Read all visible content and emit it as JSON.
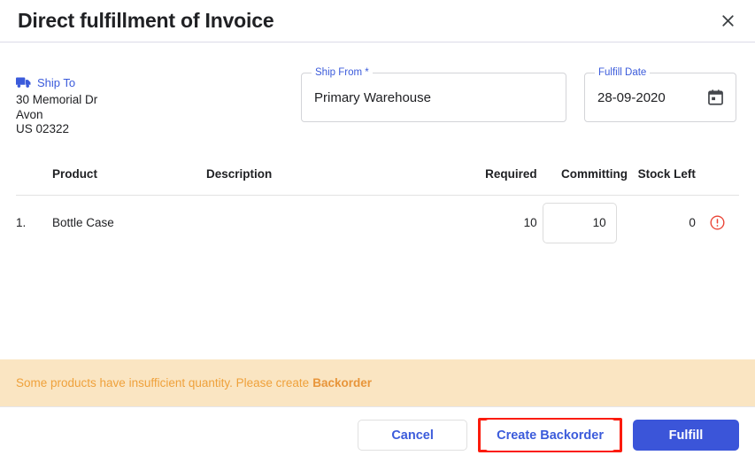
{
  "dialog": {
    "title": "Direct fulfillment of Invoice",
    "close_icon": "close-icon"
  },
  "ship_to": {
    "icon": "truck-icon",
    "label": "Ship To",
    "address_lines": [
      "30 Memorial Dr",
      "Avon",
      "US 02322"
    ]
  },
  "fields": {
    "ship_from": {
      "label": "Ship From *",
      "value": "Primary Warehouse",
      "placeholder": "Ship From"
    },
    "fulfill_date": {
      "label": "Fulfill Date",
      "value": "28-09-2020",
      "placeholder": "dd-mm-yyyy",
      "icon": "calendar-icon"
    }
  },
  "table": {
    "columns": {
      "index": "",
      "product": "Product",
      "description": "Description",
      "required": "Required",
      "committing": "Committing",
      "stock_left": "Stock Left",
      "flag": ""
    },
    "rows": [
      {
        "index": "1.",
        "product": "Bottle Case",
        "description": "",
        "required": "10",
        "committing": "10",
        "stock_left": "0",
        "flag_icon": "error-circle-icon"
      }
    ]
  },
  "banner": {
    "message": "Some products have insufficient quantity. Please create",
    "link_label": "Backorder"
  },
  "footer": {
    "cancel_label": "Cancel",
    "create_backorder_label": "Create Backorder",
    "fulfill_label": "Fulfill"
  },
  "colors": {
    "accent_blue": "#3b5bdb",
    "primary_button": "#3b55d9",
    "banner_bg": "#fae5c2",
    "banner_text": "#efa13b",
    "error_red": "#ea4335",
    "highlight_red": "#fb1b0c"
  }
}
